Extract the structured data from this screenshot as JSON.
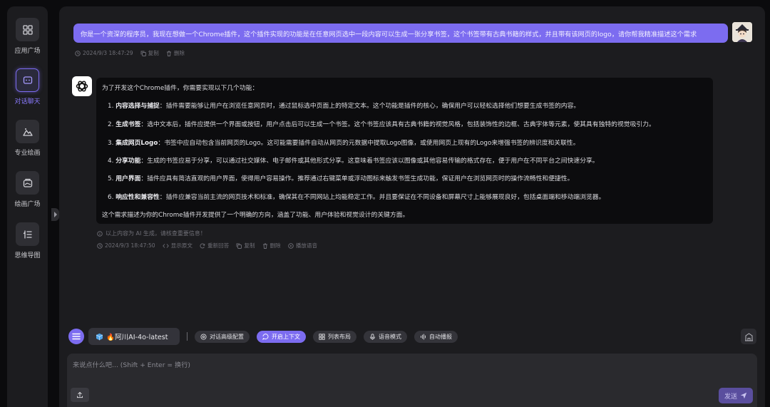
{
  "sidebar": {
    "items": [
      {
        "label": "应用广场",
        "icon": "grid-icon"
      },
      {
        "label": "对话聊天",
        "icon": "chat-icon",
        "active": true
      },
      {
        "label": "专业绘画",
        "icon": "mountain-icon"
      },
      {
        "label": "绘画广场",
        "icon": "gallery-icon"
      },
      {
        "label": "思维导图",
        "icon": "mindmap-icon"
      }
    ]
  },
  "chat": {
    "user_message": {
      "text": "你是一个资深的程序员，我现在想做一个Chrome插件，这个插件实现的功能是在任意网页选中一段内容可以生成一张分享书签，这个书签带有古典书籍的样式，并且带有该网页的logo，请你帮我精准描述这个需求",
      "timestamp": "2024/9/3 18:47:29",
      "actions": {
        "copy": "复制",
        "delete": "删除"
      }
    },
    "bot_message": {
      "intro": "为了开发这个Chrome插件，你需要实现以下几个功能：",
      "items": [
        {
          "num": "1.",
          "title": "内容选择与捕捉",
          "text": "：插件需要能够让用户在浏览任意网页时，通过鼠标选中页面上的特定文本。这个功能是插件的核心，确保用户可以轻松选择他们想要生成书签的内容。"
        },
        {
          "num": "2.",
          "title": "生成书签",
          "text": "：选中文本后，插件应提供一个界面或按钮，用户点击后可以生成一个书签。这个书签应该具有古典书籍的视觉风格，包括装饰性的边框、古典字体等元素，使其具有独特的视觉吸引力。"
        },
        {
          "num": "3.",
          "title": "集成网页Logo",
          "text": "：书签中应自动包含当前网页的Logo。这可能需要插件自动从网页的元数据中提取Logo图像，或使用网页上现有的Logo来增强书签的辨识度和关联性。"
        },
        {
          "num": "4.",
          "title": "分享功能",
          "text": "：生成的书签应易于分享，可以通过社交媒体、电子邮件或其他形式分享。这意味着书签应该以图像或其他容易传输的格式存在，便于用户在不同平台之间快速分享。"
        },
        {
          "num": "5.",
          "title": "用户界面",
          "text": "：插件应具有简洁直观的用户界面，使得用户容易操作。推荐通过右键菜单或浮动图标来触发书签生成功能，保证用户在浏览网页时的操作流畅性和便捷性。"
        },
        {
          "num": "6.",
          "title": "响应性和兼容性",
          "text": "：插件应兼容当前主流的网页技术和标准，确保其在不同网站上均能稳定工作。并且要保证在不同设备和屏幕尺寸上能够展现良好，包括桌面端和移动端浏览器。"
        }
      ],
      "outro": "这个需求描述为你的Chrome插件开发提供了一个明确的方向，涵盖了功能、用户体验和视觉设计的关键方面。",
      "ai_note": "以上内容为 AI 生成，请核查重要信息！",
      "timestamp": "2024/9/3 18:47:50",
      "actions": {
        "show_source": "显示原文",
        "regenerate": "重新回答",
        "copy": "复制",
        "delete": "删除",
        "play": "播放语音"
      }
    }
  },
  "toolbar": {
    "model": "🔥阿川AI-4o-latest",
    "buttons": [
      {
        "label": "对话高级配置",
        "icon": "settings-icon"
      },
      {
        "label": "开启上下文",
        "icon": "context-icon",
        "active": true
      },
      {
        "label": "列表布局",
        "icon": "list-layout-icon"
      },
      {
        "label": "语音模式",
        "icon": "mic-icon"
      },
      {
        "label": "自动播报",
        "icon": "broadcast-icon"
      }
    ]
  },
  "input": {
    "placeholder": "来说点什么吧... (Shift + Enter = 换行)",
    "send_label": "发送"
  }
}
